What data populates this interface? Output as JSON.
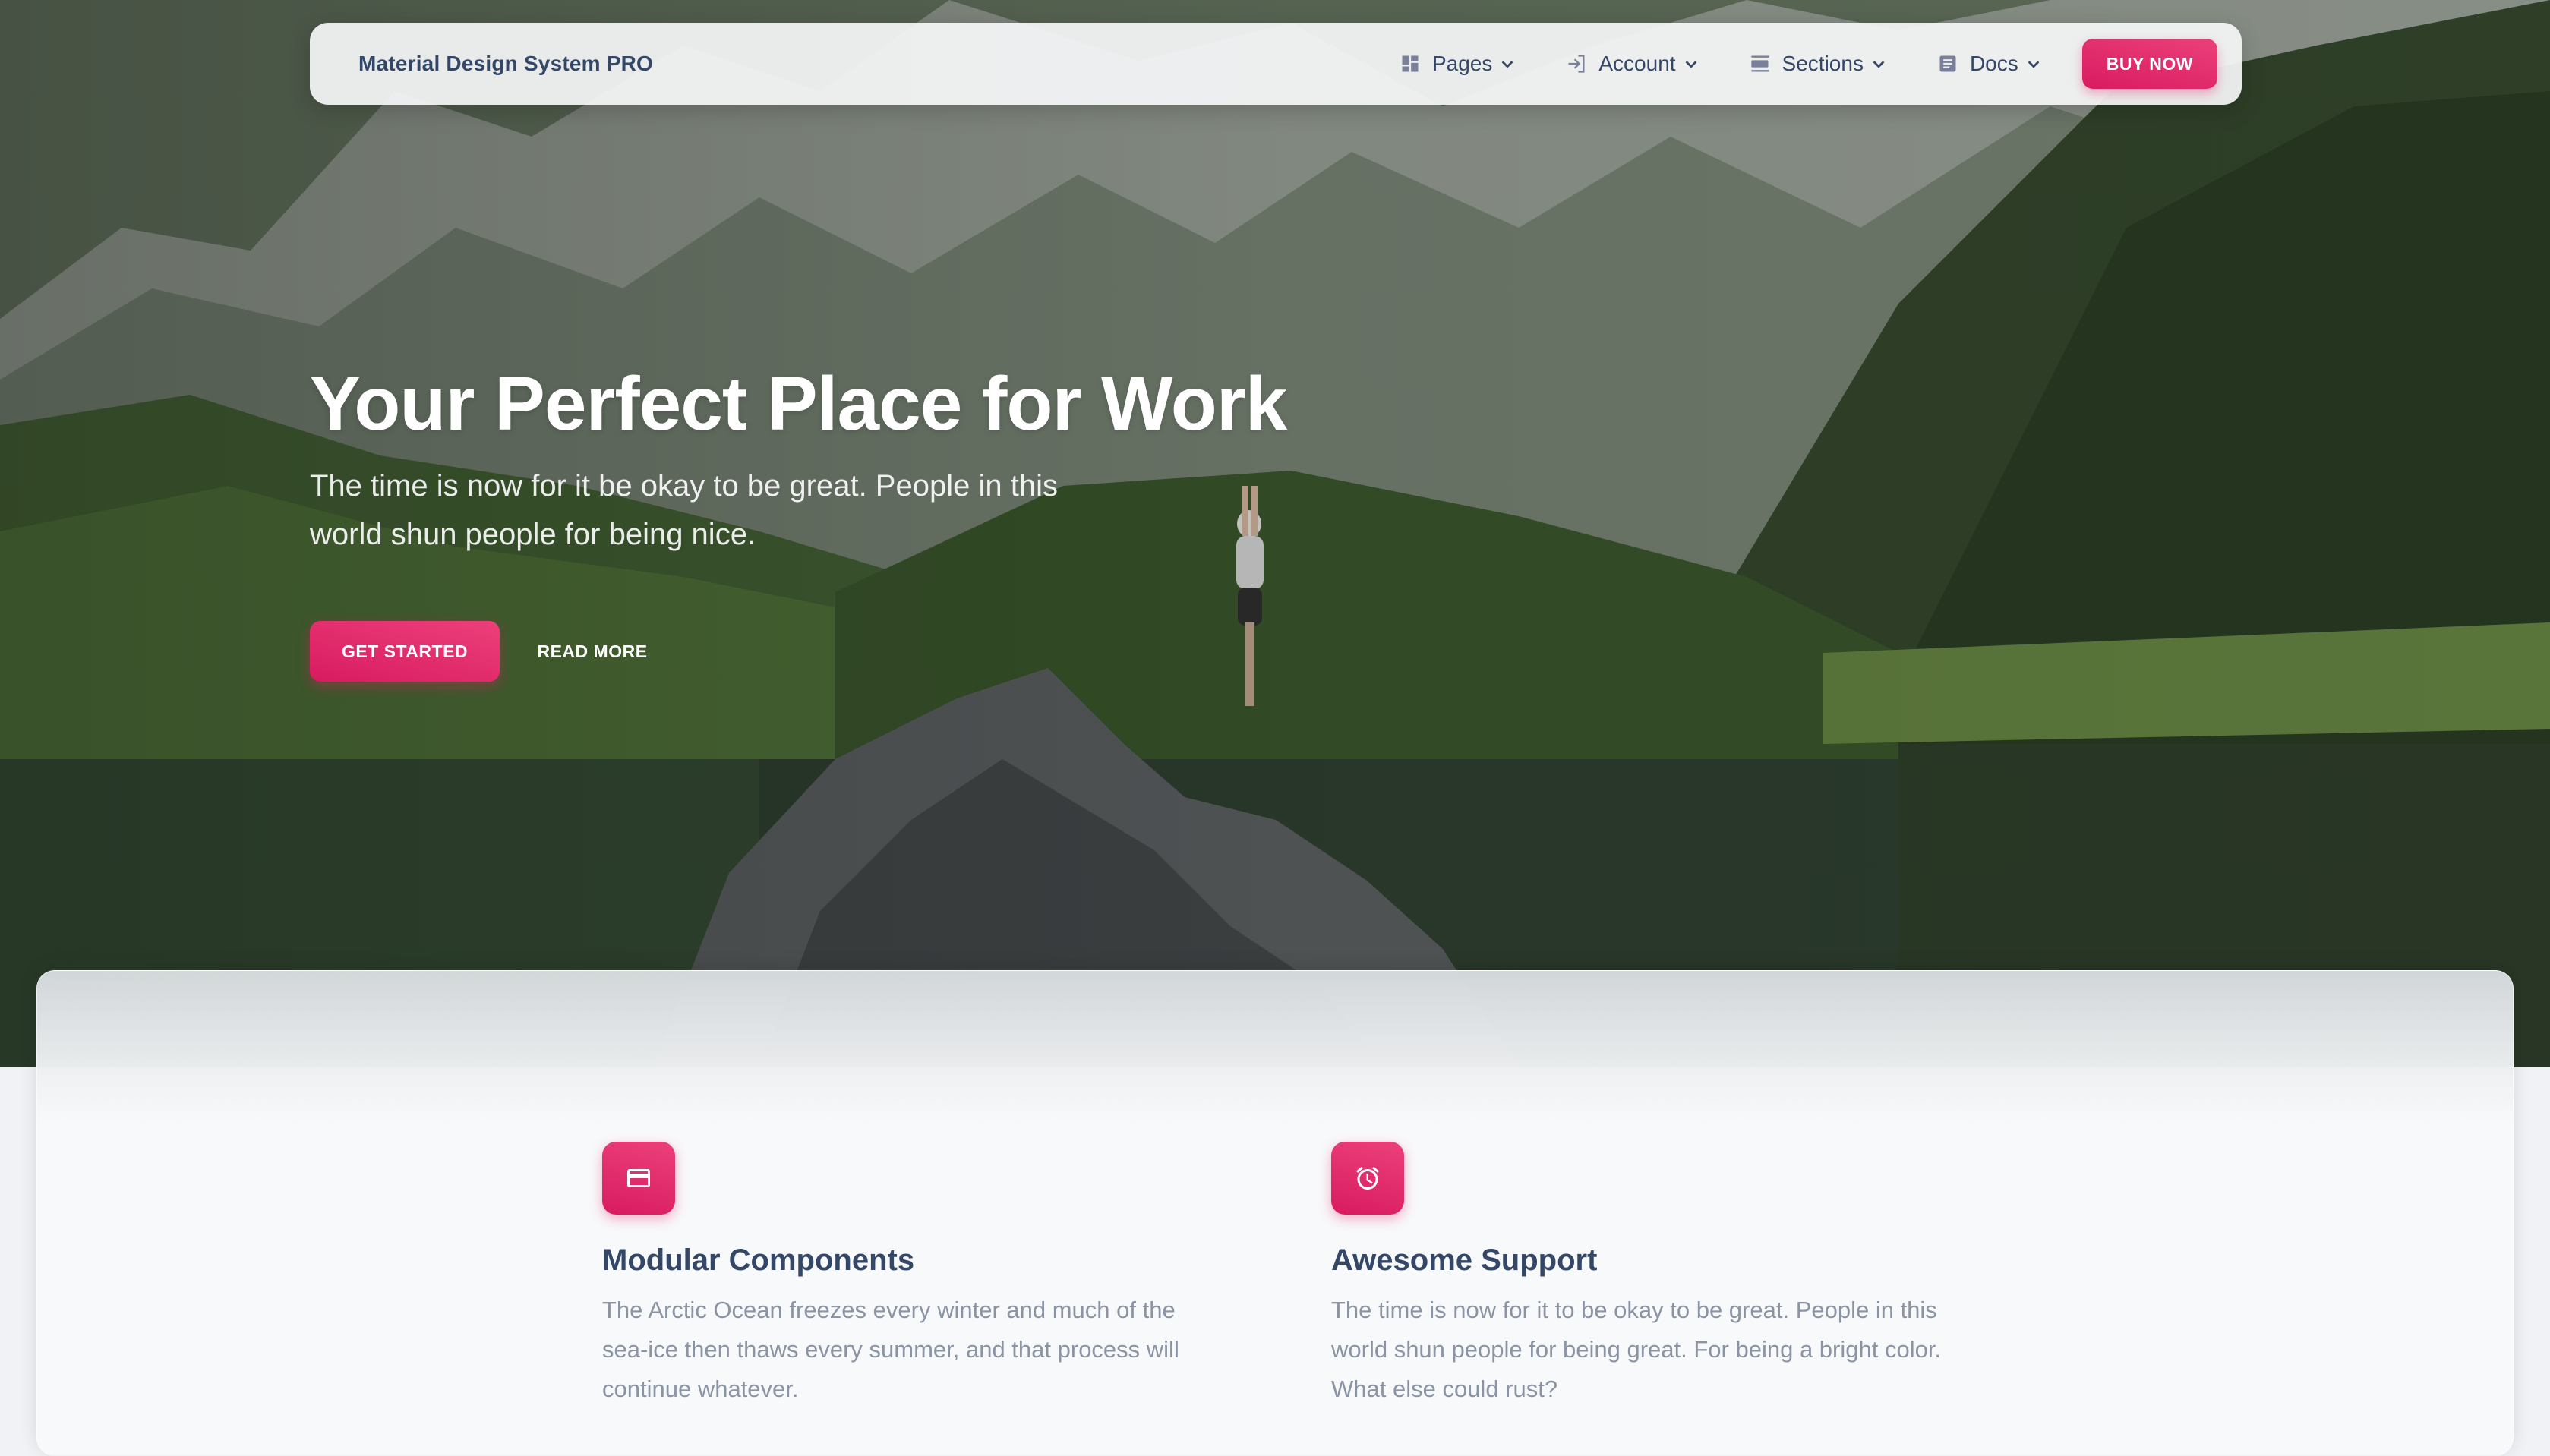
{
  "navbar": {
    "brand": "Material Design System PRO",
    "items": [
      {
        "label": "Pages",
        "icon": "dashboard-icon"
      },
      {
        "label": "Account",
        "icon": "login-icon"
      },
      {
        "label": "Sections",
        "icon": "view-day-icon"
      },
      {
        "label": "Docs",
        "icon": "article-icon"
      }
    ],
    "buy_label": "BUY NOW"
  },
  "hero": {
    "title": "Your Perfect Place for Work",
    "subtitle": "The time is now for it be okay to be great. People in this world shun people for being nice.",
    "primary_button": "GET STARTED",
    "secondary_button": "READ MORE"
  },
  "features": [
    {
      "icon": "credit-card-icon",
      "title": "Modular Components",
      "text": "The Arctic Ocean freezes every winter and much of the sea-ice then thaws every summer, and that process will continue whatever."
    },
    {
      "icon": "alarm-icon",
      "title": "Awesome Support",
      "text": "The time is now for it to be okay to be great. People in this world shun people for being great. For being a bright color. What else could rust?"
    }
  ],
  "colors": {
    "accent": "#e91e63",
    "text_dark": "#344767",
    "text_muted": "#8a94a4"
  }
}
